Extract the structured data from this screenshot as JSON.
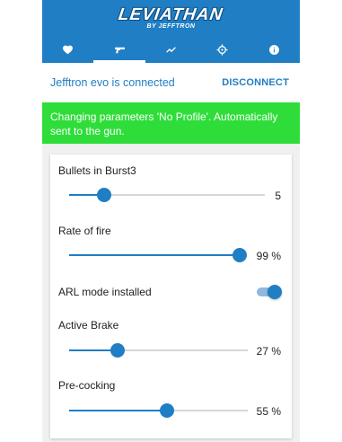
{
  "header": {
    "logo_text": "LEVIATHAN",
    "logo_subtext": "BY JEFFTRON",
    "tabs": [
      {
        "icon": "heart-icon",
        "active": false
      },
      {
        "icon": "gun-icon",
        "active": true
      },
      {
        "icon": "chart-line-icon",
        "active": false
      },
      {
        "icon": "crosshair-icon",
        "active": false
      },
      {
        "icon": "info-icon",
        "active": false
      }
    ]
  },
  "connection": {
    "status_text": "Jefftron evo is connected",
    "disconnect_label": "DISCONNECT"
  },
  "notice": {
    "text": "Changing parameters 'No Profile'. Automatically sent to the gun."
  },
  "settings": {
    "bullets_in_burst": {
      "label": "Bullets in Burst3",
      "value_text": "5",
      "level": 0.18
    },
    "rate_of_fire": {
      "label": "Rate of fire",
      "value_text": "99 %",
      "level": 0.99
    },
    "arl_mode": {
      "label": "ARL mode installed",
      "enabled": true
    },
    "active_brake": {
      "label": "Active Brake",
      "value_text": "27 %",
      "level": 0.27
    },
    "pre_cocking": {
      "label": "Pre-cocking",
      "value_text": "55 %",
      "level": 0.55
    }
  },
  "colors": {
    "primary": "#1f7ec4",
    "notice_bg": "#2fdd3a",
    "track": "#d6d6d6"
  }
}
